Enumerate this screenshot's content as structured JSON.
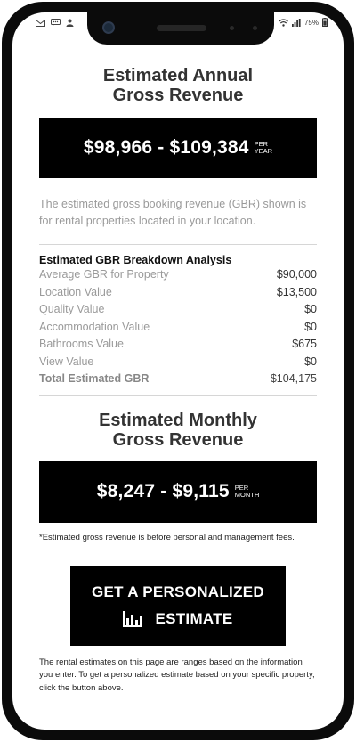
{
  "status_bar": {
    "battery": "75%",
    "left_icons": [
      "mail-icon",
      "message-icon",
      "person-icon"
    ],
    "right_icons": [
      "wifi-icon",
      "signal-icon",
      "battery-icon"
    ]
  },
  "annual": {
    "title_line1": "Estimated Annual",
    "title_line2": "Gross Revenue",
    "range": "$98,966 - $109,384",
    "unit_line1": "PER",
    "unit_line2": "YEAR"
  },
  "description": "The estimated gross booking revenue (GBR) shown is for rental properties located in your location.",
  "breakdown": {
    "title": "Estimated GBR Breakdown Analysis",
    "rows": [
      {
        "label": "Average GBR for Property",
        "value": "$90,000"
      },
      {
        "label": "Location Value",
        "value": "$13,500"
      },
      {
        "label": "Quality Value",
        "value": "$0"
      },
      {
        "label": "Accommodation Value",
        "value": "$0"
      },
      {
        "label": "Bathrooms Value",
        "value": "$675"
      },
      {
        "label": "View Value",
        "value": "$0"
      }
    ],
    "total_label": "Total Estimated GBR",
    "total_value": "$104,175"
  },
  "monthly": {
    "title_line1": "Estimated Monthly",
    "title_line2": "Gross Revenue",
    "range": "$8,247 - $9,115",
    "unit_line1": "PER",
    "unit_line2": "MONTH"
  },
  "note": "*Estimated gross revenue is before personal and management fees.",
  "cta": {
    "line1": "GET A PERSONALIZED",
    "line2": "ESTIMATE",
    "icon": "bar-chart-icon"
  },
  "footer": "The rental estimates on this page are ranges based on the information you enter. To get a personalized estimate based on your specific property, click the button above.",
  "colors": {
    "box_background": "#000000",
    "muted_text": "#9a9a9a",
    "divider": "#d6d6d6"
  }
}
